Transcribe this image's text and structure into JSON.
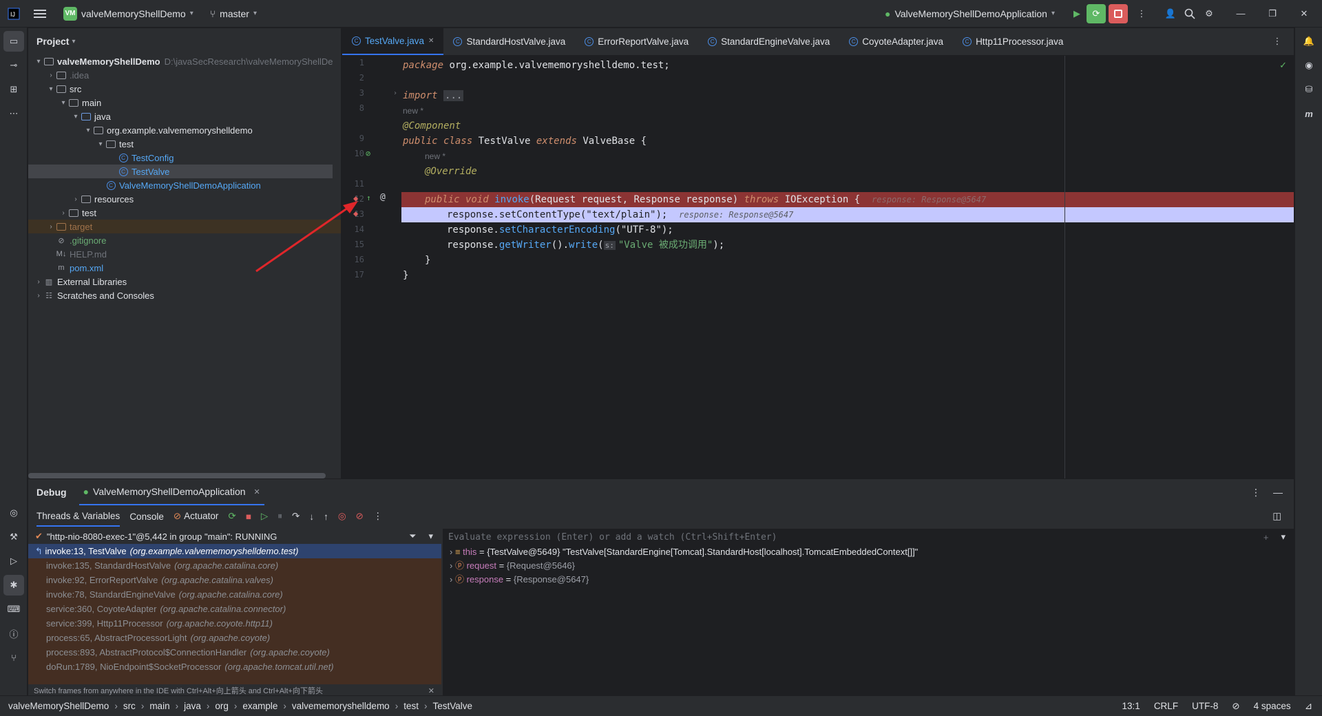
{
  "titlebar": {
    "project_badge": "VM",
    "project_name": "valveMemoryShellDemo",
    "branch": "master",
    "run_config": "ValveMemoryShellDemoApplication"
  },
  "project_panel": {
    "title": "Project",
    "tree": [
      {
        "label": "valveMemoryShellDemo",
        "path": "D:\\javaSecResearch\\valveMemoryShellDe",
        "indent": 0,
        "arrow": "down",
        "icon": "module",
        "bold": true
      },
      {
        "label": ".idea",
        "indent": 1,
        "arrow": "right",
        "icon": "folder",
        "muted": true
      },
      {
        "label": "src",
        "indent": 1,
        "arrow": "down",
        "icon": "folder"
      },
      {
        "label": "main",
        "indent": 2,
        "arrow": "down",
        "icon": "folder"
      },
      {
        "label": "java",
        "indent": 3,
        "arrow": "down",
        "icon": "folder-blue"
      },
      {
        "label": "org.example.valvememoryshelldemo",
        "indent": 4,
        "arrow": "down",
        "icon": "package"
      },
      {
        "label": "test",
        "indent": 5,
        "arrow": "down",
        "icon": "package"
      },
      {
        "label": "TestConfig",
        "indent": 6,
        "arrow": "",
        "icon": "class",
        "color": "#56a8f5"
      },
      {
        "label": "TestValve",
        "indent": 6,
        "arrow": "",
        "icon": "class",
        "color": "#56a8f5",
        "selected": true
      },
      {
        "label": "ValveMemoryShellDemoApplication",
        "indent": 5,
        "arrow": "",
        "icon": "class-spring",
        "color": "#56a8f5"
      },
      {
        "label": "resources",
        "indent": 3,
        "arrow": "right",
        "icon": "folder"
      },
      {
        "label": "test",
        "indent": 2,
        "arrow": "right",
        "icon": "folder"
      },
      {
        "label": "target",
        "indent": 1,
        "arrow": "right",
        "icon": "folder-orange",
        "color": "#a0724a",
        "highlight": true
      },
      {
        "label": ".gitignore",
        "indent": 1,
        "arrow": "",
        "icon": "ignore",
        "color": "#6aab73"
      },
      {
        "label": "HELP.md",
        "indent": 1,
        "arrow": "",
        "icon": "md",
        "muted": true
      },
      {
        "label": "pom.xml",
        "indent": 1,
        "arrow": "",
        "icon": "maven",
        "color": "#56a8f5"
      },
      {
        "label": "External Libraries",
        "indent": 0,
        "arrow": "right",
        "icon": "libs"
      },
      {
        "label": "Scratches and Consoles",
        "indent": 0,
        "arrow": "right",
        "icon": "scratch"
      }
    ]
  },
  "editor_tabs": [
    {
      "label": "TestValve.java",
      "active": true
    },
    {
      "label": "StandardHostValve.java"
    },
    {
      "label": "ErrorReportValve.java"
    },
    {
      "label": "StandardEngineValve.java"
    },
    {
      "label": "CoyoteAdapter.java"
    },
    {
      "label": "Http11Processor.java"
    }
  ],
  "editor": {
    "line_numbers": [
      "1",
      "2",
      "3",
      "8",
      "9",
      "10",
      "11",
      "12",
      "13",
      "14",
      "15",
      "16",
      "17"
    ],
    "hints": {
      "new1": "new *",
      "new2": "new *"
    },
    "code": {
      "l1_kw": "package",
      "l1_rest": " org.example.valvememoryshelldemo.test;",
      "l3_kw": "import",
      "l3_fold": "...",
      "l9": "@Component",
      "l10_a": "public class",
      "l10_b": " TestValve ",
      "l10_c": "extends",
      "l10_d": " ValveBase {",
      "l11": "@Override",
      "l12_a": "public void",
      "l12_b": "invoke",
      "l12_c": "(Request request, Response response) ",
      "l12_d": "throws",
      "l12_e": " IOException {",
      "l12_inlay": "response: Response@5647",
      "l13_a": "response.",
      "l13_b": "setContentType",
      "l13_c": "(\"text/plain\");",
      "l13_inlay": "response: Response@5647",
      "l14_a": "response.",
      "l14_b": "setCharacterEncoding",
      "l14_c": "(\"UTF-8\");",
      "l15_a": "response.",
      "l15_b": "getWriter",
      "l15_c": "().",
      "l15_d": "write",
      "l15_e": "(",
      "l15_s": "s:",
      "l15_str": "\"Valve 被成功调用\"",
      "l15_end": ");",
      "l16": "}",
      "l17": "}"
    }
  },
  "debug": {
    "title": "Debug",
    "session": "ValveMemoryShellDemoApplication",
    "tabs": {
      "threads": "Threads & Variables",
      "console": "Console",
      "actuator": "Actuator"
    },
    "thread": "\"http-nio-8080-exec-1\"@5,442 in group \"main\": RUNNING",
    "frames": [
      {
        "method": "invoke:13, TestValve",
        "pkg": "(org.example.valvememoryshelldemo.test)",
        "selected": true
      },
      {
        "method": "invoke:135, StandardHostValve",
        "pkg": "(org.apache.catalina.core)"
      },
      {
        "method": "invoke:92, ErrorReportValve",
        "pkg": "(org.apache.catalina.valves)"
      },
      {
        "method": "invoke:78, StandardEngineValve",
        "pkg": "(org.apache.catalina.core)"
      },
      {
        "method": "service:360, CoyoteAdapter",
        "pkg": "(org.apache.catalina.connector)"
      },
      {
        "method": "service:399, Http11Processor",
        "pkg": "(org.apache.coyote.http11)"
      },
      {
        "method": "process:65, AbstractProcessorLight",
        "pkg": "(org.apache.coyote)"
      },
      {
        "method": "process:893, AbstractProtocol$ConnectionHandler",
        "pkg": "(org.apache.coyote)"
      },
      {
        "method": "doRun:1789, NioEndpoint$SocketProcessor",
        "pkg": "(org.apache.tomcat.util.net)"
      }
    ],
    "frames_tip": "Switch frames from anywhere in the IDE with Ctrl+Alt+向上箭头 and Ctrl+Alt+向下箭头",
    "eval_placeholder": "Evaluate expression (Enter) or add a watch (Ctrl+Shift+Enter)",
    "vars": [
      {
        "name": "this",
        "value": "{TestValve@5649} \"TestValve[StandardEngine[Tomcat].StandardHost[localhost].TomcatEmbeddedContext[]]\""
      },
      {
        "name": "request",
        "value": "{Request@5646}"
      },
      {
        "name": "response",
        "value": "{Response@5647}"
      }
    ]
  },
  "statusbar": {
    "crumbs": [
      "valveMemoryShellDemo",
      "src",
      "main",
      "java",
      "org",
      "example",
      "valvememoryshelldemo",
      "test",
      "TestValve"
    ],
    "position": "13:1",
    "line_sep": "CRLF",
    "encoding": "UTF-8",
    "indent": "4 spaces"
  }
}
